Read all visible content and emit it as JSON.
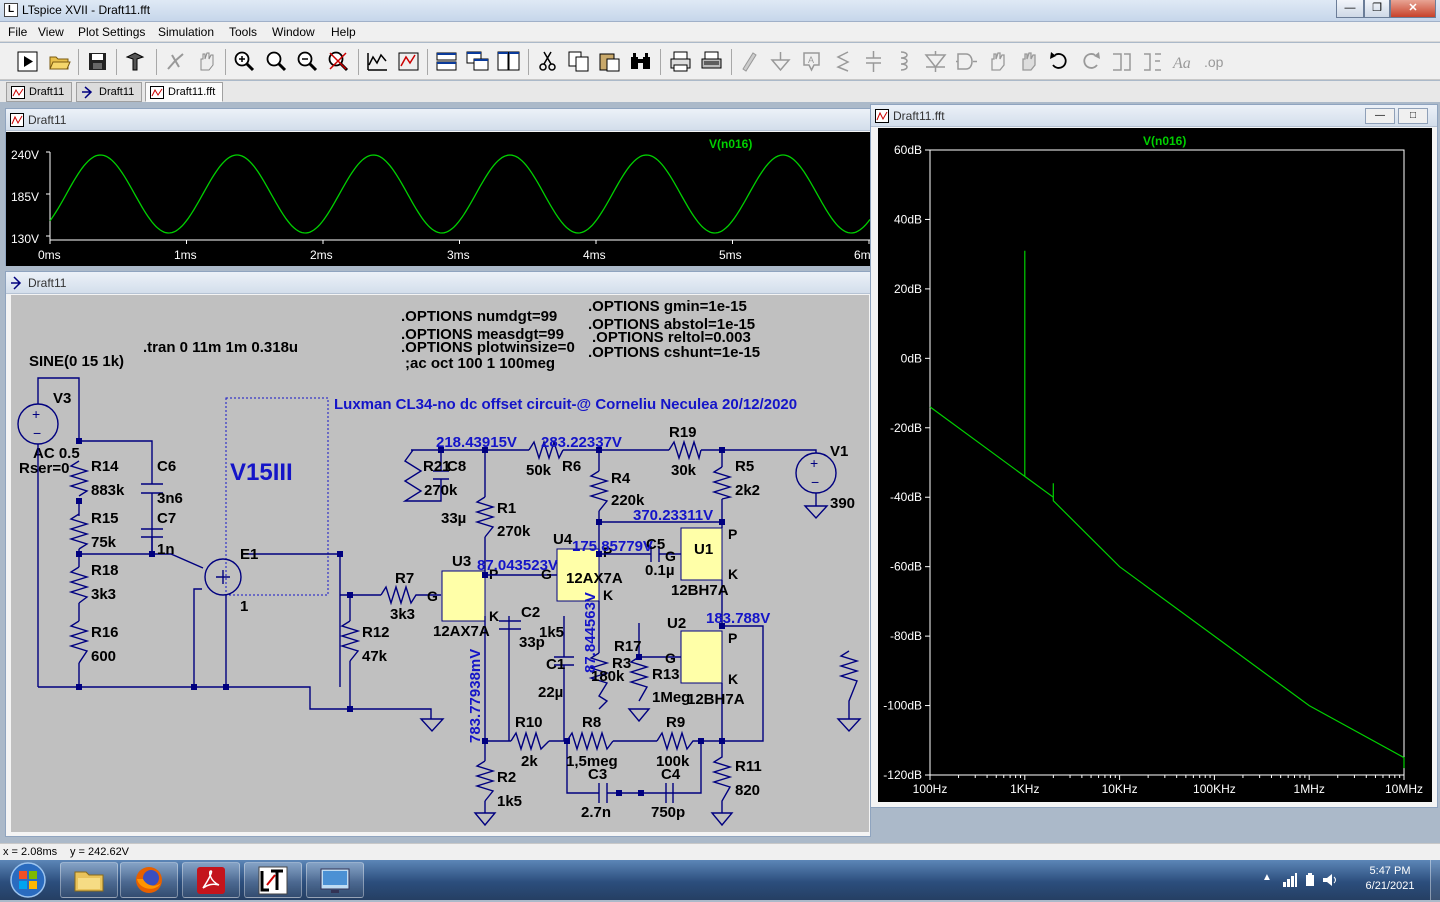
{
  "window": {
    "title": "LTspice XVII - Draft11.fft",
    "min_label": "—",
    "max_label": "❐",
    "close_label": "✕"
  },
  "menu": {
    "file": "File",
    "view": "View",
    "plot_settings": "Plot Settings",
    "simulation": "Simulation",
    "tools": "Tools",
    "window": "Window",
    "help": "Help"
  },
  "toolbar_icons": [
    "run-icon",
    "open-icon",
    "save-icon",
    "control-panel-icon",
    "halt-icon",
    "pan-icon",
    "zoom-in-icon",
    "zoom-full-icon",
    "zoom-out-icon",
    "zoom-cancel-icon",
    "autorange-icon",
    "mark-icon",
    "tile-horizontal-icon",
    "cascade-icon",
    "tile-vertical-icon",
    "cut-icon",
    "copy-icon",
    "paste-icon",
    "find-icon",
    "print-icon",
    "print-setup-icon",
    "wire-icon",
    "ground-icon",
    "label-icon",
    "resistor-icon",
    "capacitor-icon",
    "inductor-icon",
    "diode-icon",
    "component-icon",
    "move-icon",
    "drag-icon",
    "undo-icon",
    "redo-icon",
    "rotate-icon",
    "mirror-icon",
    "text-icon",
    "spice-directive-icon"
  ],
  "tabs": [
    {
      "label": "Draft11",
      "kind": "waveform"
    },
    {
      "label": "Draft11",
      "kind": "schematic"
    },
    {
      "label": "Draft11.fft",
      "kind": "fft"
    }
  ],
  "waveform_window": {
    "title": "Draft11",
    "trace_name": "V(n016)",
    "trace_color": "#00d000",
    "y_ticks": [
      "240V",
      "185V",
      "130V"
    ],
    "x_ticks": [
      "0ms",
      "1ms",
      "2ms",
      "3ms",
      "4ms",
      "5ms",
      "6m"
    ]
  },
  "schematic_window": {
    "title": "Draft11",
    "directives": {
      "numdgt": ".OPTIONS numdgt=99",
      "measdgt": ".OPTIONS measdgt=99",
      "plotwinsize": ".OPTIONS plotwinsize=0",
      "ac": ";ac oct 100 1 100meg",
      "gmin": ".OPTIONS gmin=1e-15",
      "abstol": ".OPTIONS abstol=1e-15",
      "reltol": ".OPTIONS reltol=0.003",
      "cshunt": ".OPTIONS cshunt=1e-15",
      "tran": ".tran 0 11m 1m 0.318u"
    },
    "circuit_title": "Luxman CL34-no dc offset circuit-@ Corneliu Neculea 20/12/2020",
    "block_label": "V15III",
    "source_v3": {
      "name": "V3",
      "value": "SINE(0 15 1k)",
      "ac": "AC 0.5",
      "rser": "Rser=0"
    },
    "source_v1": {
      "name": "V1",
      "value": "390"
    },
    "e1": {
      "name": "E1",
      "gain": "1"
    },
    "components": [
      {
        "ref": "R14",
        "value": "883k"
      },
      {
        "ref": "R15",
        "value": "75k"
      },
      {
        "ref": "R18",
        "value": "3k3"
      },
      {
        "ref": "R16",
        "value": "600"
      },
      {
        "ref": "C6",
        "value": "3n6"
      },
      {
        "ref": "C7",
        "value": "1n"
      },
      {
        "ref": "R7",
        "value": "3k3"
      },
      {
        "ref": "R12",
        "value": "47k"
      },
      {
        "ref": "R21",
        "value": "270k"
      },
      {
        "ref": "C8",
        "value": "33µ"
      },
      {
        "ref": "R1",
        "value": "270k"
      },
      {
        "ref": "R6",
        "value": "50k"
      },
      {
        "ref": "R4",
        "value": "220k"
      },
      {
        "ref": "R19",
        "value": "30k"
      },
      {
        "ref": "R5",
        "value": "2k2"
      },
      {
        "ref": "C5",
        "value": "0.1µ"
      },
      {
        "ref": "C2",
        "value": "1k5"
      },
      {
        "ref": "C2b",
        "value": "33p"
      },
      {
        "ref": "C1",
        "value": "22µ"
      },
      {
        "ref": "R3",
        "value": "180k"
      },
      {
        "ref": "R17",
        "value": ""
      },
      {
        "ref": "R13",
        "value": "1Meg"
      },
      {
        "ref": "R10",
        "value": "2k"
      },
      {
        "ref": "R8",
        "value": "1,5meg"
      },
      {
        "ref": "R9",
        "value": "100k"
      },
      {
        "ref": "C3",
        "value": "2.7n"
      },
      {
        "ref": "C4",
        "value": "750p"
      },
      {
        "ref": "R2",
        "value": "1k5"
      },
      {
        "ref": "R11",
        "value": "820"
      }
    ],
    "tubes": [
      {
        "ref": "U3",
        "model": "12AX7A"
      },
      {
        "ref": "U4",
        "model": "12AX7A"
      },
      {
        "ref": "U1",
        "model": "12BH7A"
      },
      {
        "ref": "U2",
        "model": "12BH7A"
      }
    ],
    "pins": {
      "p": "P",
      "g": "G",
      "k": "K"
    },
    "voltages": {
      "n1": "218.43915V",
      "n2": "283.22337V",
      "n3": "370.23311V",
      "n4": "175.85779V",
      "n5": "87.043523V",
      "n6": "183.788V",
      "n7": "783.77938mV",
      "n8": "87.844563V"
    }
  },
  "fft_window": {
    "title": "Draft11.fft",
    "trace_name": "V(n016)",
    "trace_color": "#00d000",
    "y_ticks": [
      "60dB",
      "40dB",
      "20dB",
      "0dB",
      "-20dB",
      "-40dB",
      "-60dB",
      "-80dB",
      "-100dB",
      "-120dB"
    ],
    "x_ticks": [
      "100Hz",
      "1KHz",
      "10KHz",
      "100KHz",
      "1MHz",
      "10MHz"
    ],
    "ylim": [
      -120,
      60
    ],
    "x_scale": "log",
    "chart_data": {
      "type": "line",
      "series": [
        {
          "name": "V(n016)",
          "x": [
            100,
            1000,
            1000,
            1000,
            2000,
            2000,
            2000,
            10000,
            100000,
            1000000,
            10000000,
            30000000
          ],
          "y": [
            -14,
            -34,
            31,
            -34,
            -40,
            -36,
            -41,
            -60,
            -80,
            -100,
            -115,
            -118
          ]
        }
      ]
    }
  },
  "status": {
    "cursor_x": "x = 2.08ms",
    "cursor_y": "y = 242.62V"
  },
  "taskbar": {
    "apps": [
      "windows-explorer",
      "firefox",
      "acrobat",
      "ltspice",
      "desktop-viewer"
    ],
    "clock_time": "5:47 PM",
    "clock_date": "6/21/2021"
  }
}
